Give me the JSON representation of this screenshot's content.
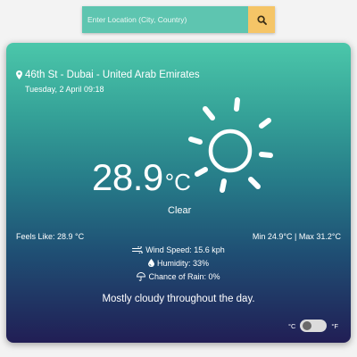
{
  "search": {
    "placeholder": "Enter Location (City, Country)",
    "button_icon": "search-icon"
  },
  "weather": {
    "location": "46th St - Dubai - United Arab Emirates",
    "date": "Tuesday, 2 April 09:18",
    "temperature": "28.9",
    "temperature_unit": "°C",
    "condition": "Clear",
    "condition_icon": "sun-icon",
    "feels_like": "Feels Like: 28.9 °C",
    "min_max": "Min 24.9°C | Max 31.2°C",
    "wind_speed": "Wind Speed: 15.6 kph",
    "humidity": "Humidity: 33%",
    "chance_of_rain": "Chance of Rain: 0%",
    "summary": "Mostly cloudy throughout the day."
  },
  "unit_toggle": {
    "celsius_label": "°C",
    "fahrenheit_label": "°F",
    "selected": "°C"
  },
  "colors": {
    "search_field": "#5ec5b0",
    "search_button": "#f5c567",
    "card_top": "#4bc7aa",
    "card_bottom": "#211e55",
    "text": "#ffffff"
  }
}
